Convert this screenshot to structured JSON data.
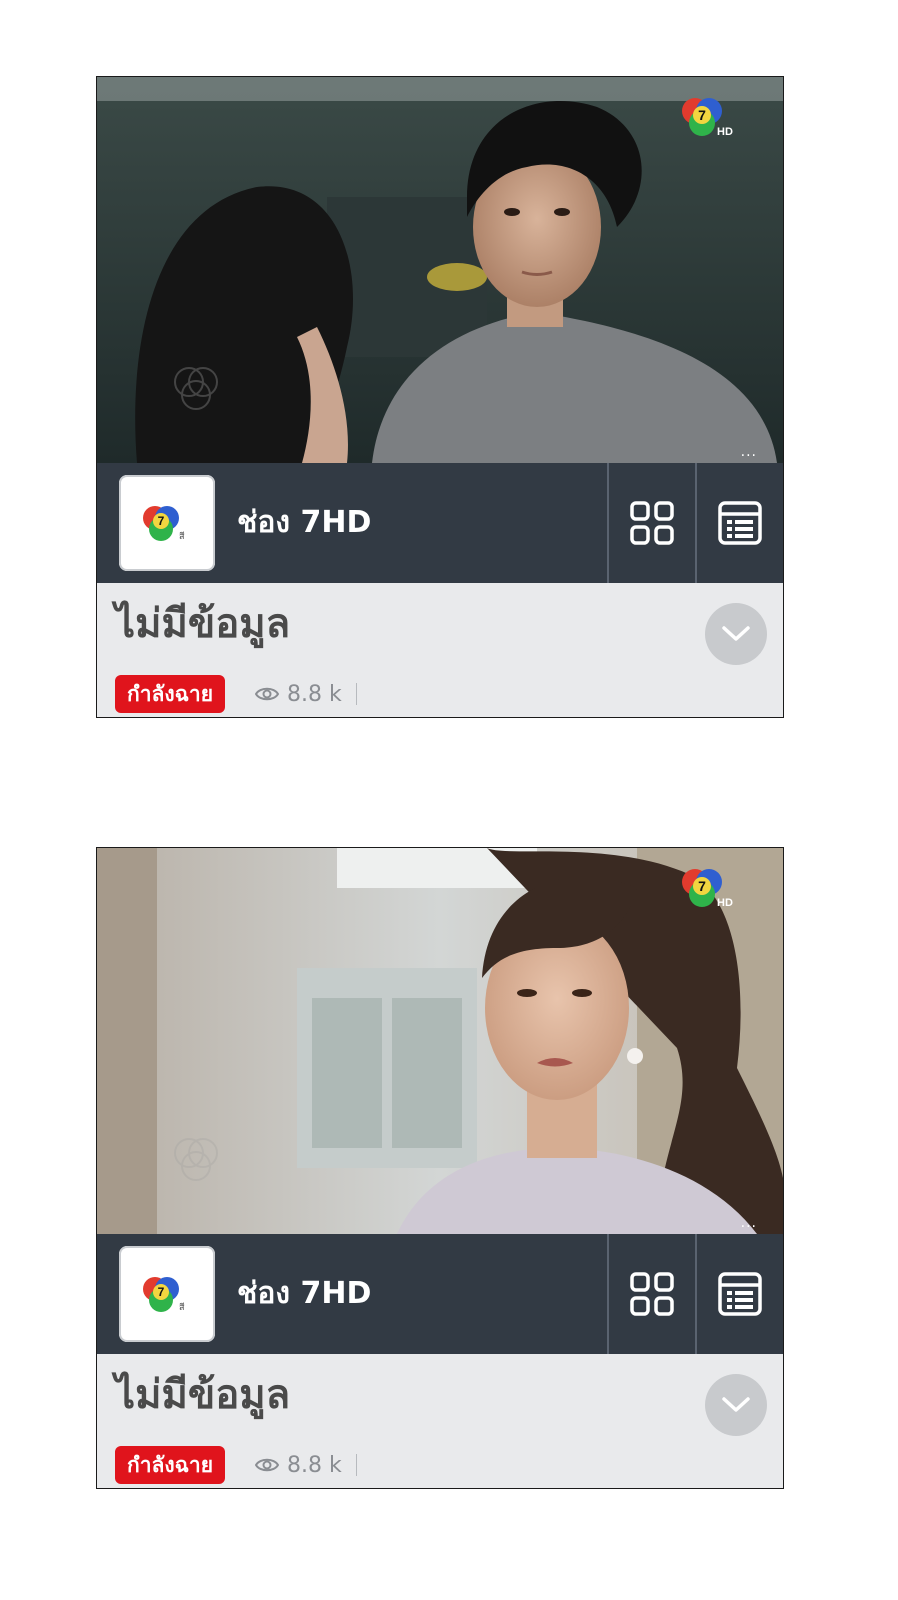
{
  "cards": [
    {
      "channel_name": "ช่อง 7HD",
      "program_title": "ไม่มีข้อมูล",
      "live_badge": "กำลังฉาย",
      "view_count": "8.8 k",
      "more_label": "...",
      "scene": "man in gray t-shirt in parking garage"
    },
    {
      "channel_name": "ช่อง 7HD",
      "program_title": "ไม่มีข้อมูล",
      "live_badge": "กำลังฉาย",
      "view_count": "8.8 k",
      "more_label": "...",
      "scene": "woman in hospital corridor"
    }
  ],
  "icons": {
    "grid": "grid-view-icon",
    "list": "list-view-icon",
    "expand": "chevron-down-icon",
    "views": "eye-icon",
    "logo": "channel-7-logo"
  },
  "colors": {
    "bar_bg": "#323a44",
    "info_bg": "#e9eaec",
    "live_red": "#e0141c"
  }
}
